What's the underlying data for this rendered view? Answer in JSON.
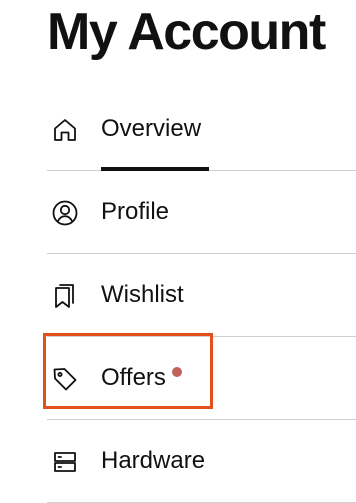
{
  "page": {
    "title": "My Account"
  },
  "menu": {
    "items": [
      {
        "id": "overview",
        "label": "Overview",
        "icon": "home-icon",
        "active": true
      },
      {
        "id": "profile",
        "label": "Profile",
        "icon": "user-circle-icon",
        "active": false
      },
      {
        "id": "wishlist",
        "label": "Wishlist",
        "icon": "bookmarks-icon",
        "active": false
      },
      {
        "id": "offers",
        "label": "Offers",
        "icon": "tag-icon",
        "active": false,
        "has_notification": true
      },
      {
        "id": "hardware",
        "label": "Hardware",
        "icon": "server-icon",
        "active": false
      }
    ]
  },
  "colors": {
    "text": "#111111",
    "divider": "#cfcfcf",
    "notification_dot": "#c0625a",
    "highlight_border": "#e2501e"
  }
}
